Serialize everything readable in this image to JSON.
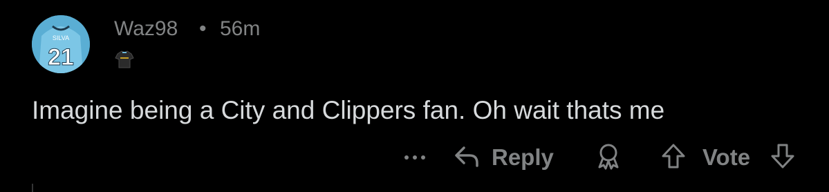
{
  "comment": {
    "author": "Waz98",
    "separator": "•",
    "time_ago": "56m",
    "body": "Imagine being a City and Clippers fan. Oh wait thats me",
    "avatar": {
      "jersey_number": "21",
      "jersey_name": "SILVA"
    },
    "flair_icon": "jersey-flair-icon"
  },
  "actions": {
    "more_icon": "more-options-icon",
    "reply_label": "Reply",
    "reply_icon": "reply-arrow-icon",
    "award_icon": "award-icon",
    "upvote_icon": "upvote-arrow-icon",
    "vote_label": "Vote",
    "downvote_icon": "downvote-arrow-icon"
  },
  "colors": {
    "background": "#000000",
    "meta_text": "#818384",
    "body_text": "#d7dadc",
    "avatar_blue": "#6db7da"
  }
}
